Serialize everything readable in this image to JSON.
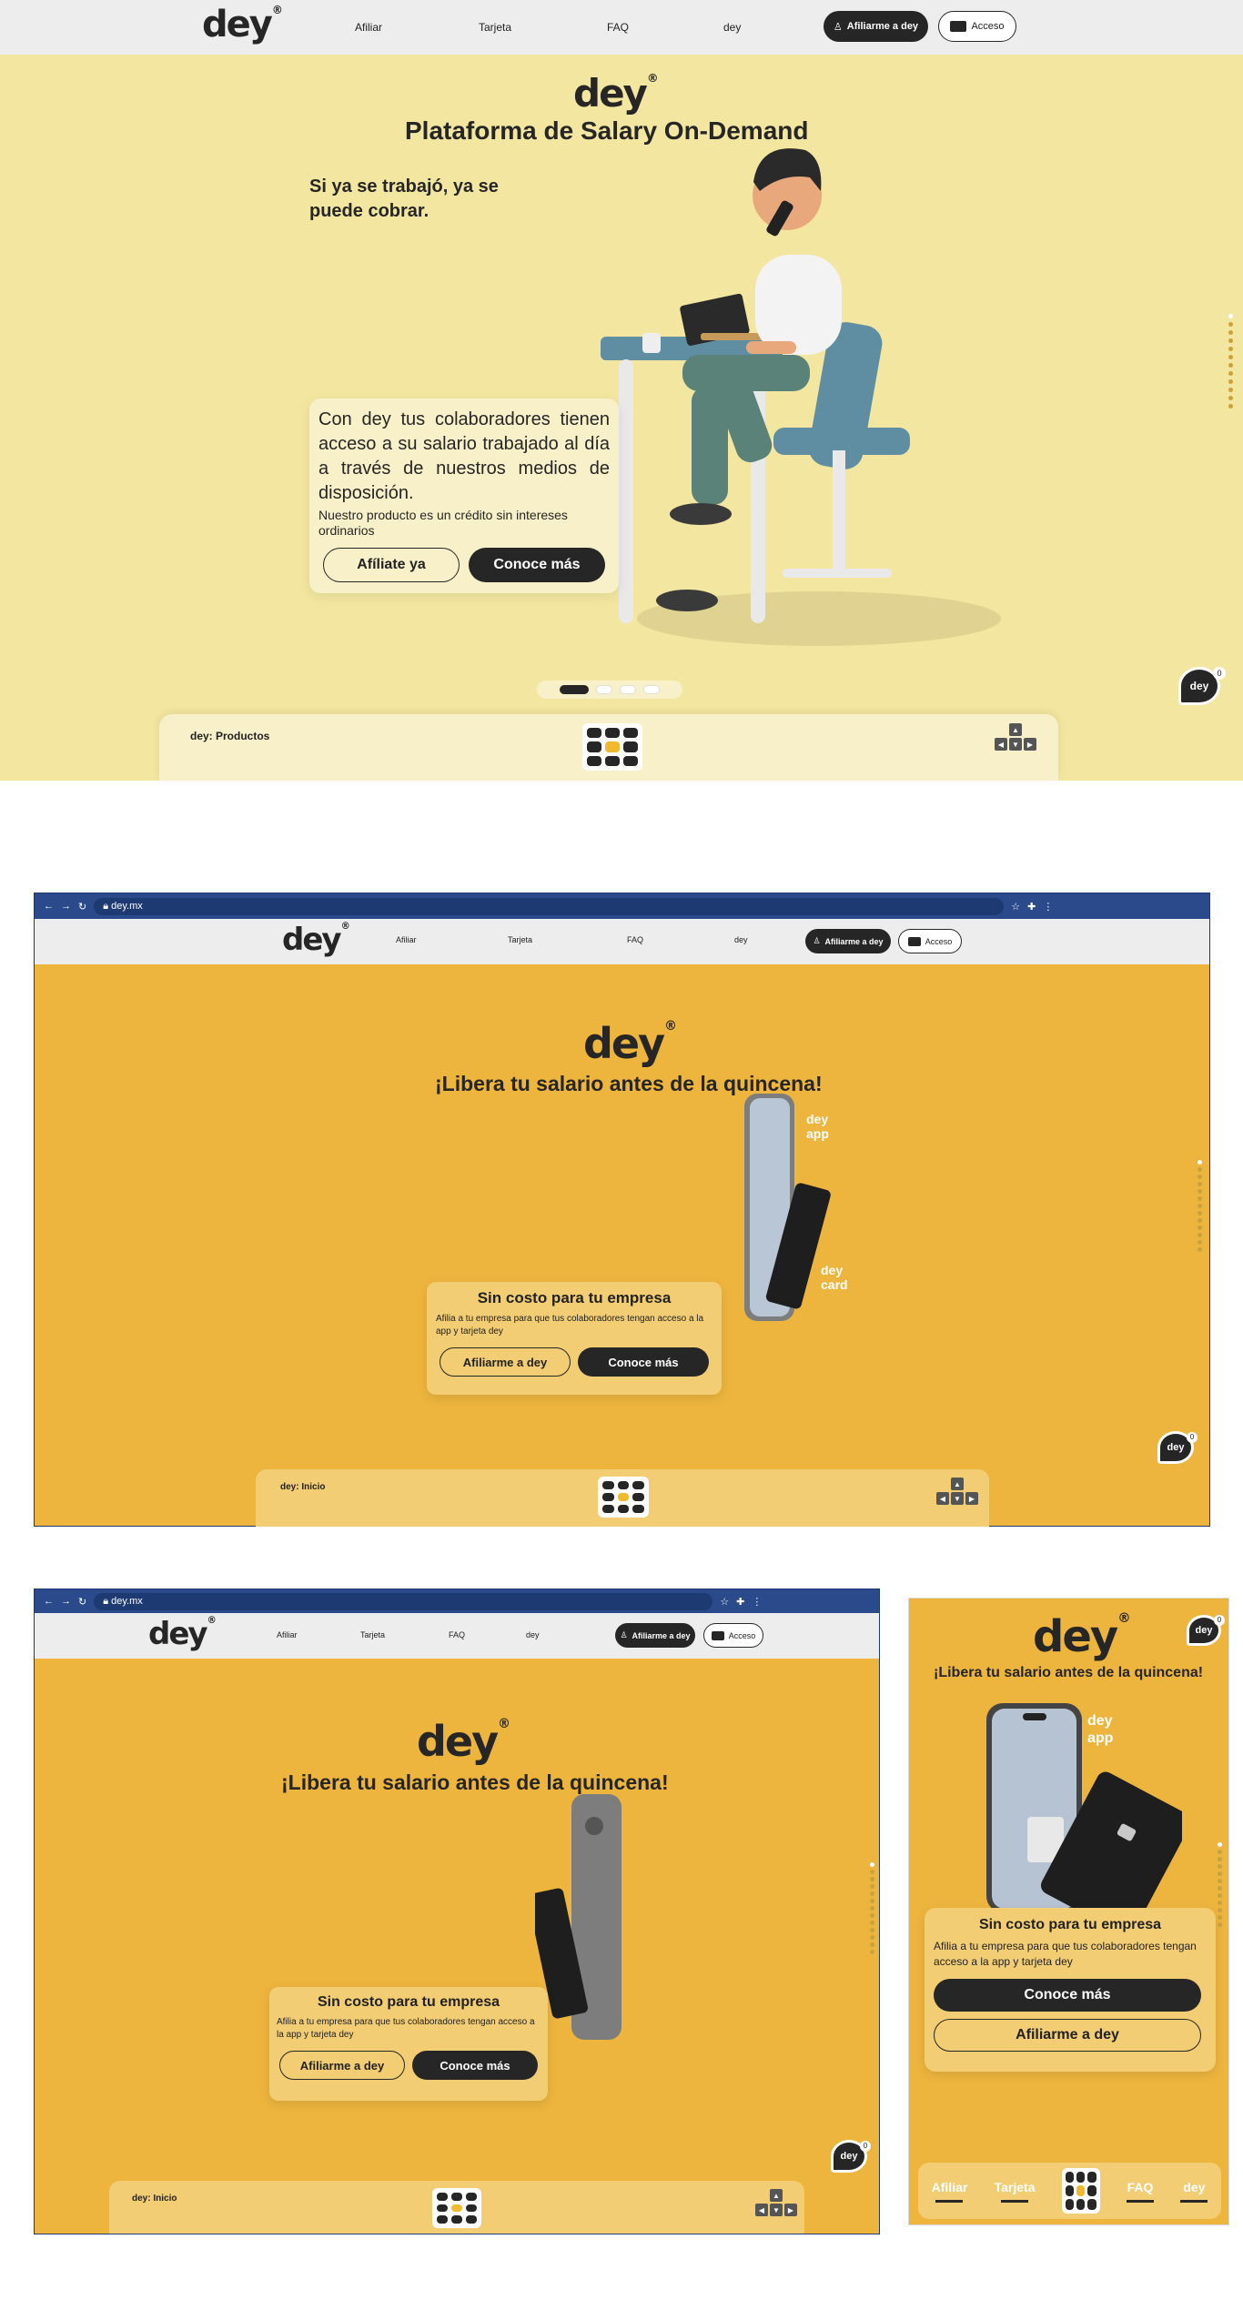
{
  "brand": {
    "logo": "dey",
    "reg": "®"
  },
  "nav": {
    "items": [
      "Afiliar",
      "Tarjeta",
      "FAQ",
      "dey"
    ],
    "cta_affiliate": "Afiliarme a dey",
    "cta_access": "Acceso"
  },
  "hero1": {
    "title": "Plataforma de Salary On-Demand",
    "tagline": "Si ya se trabajó, ya se puede cobrar.",
    "card_body": "Con dey tus colaboradores tienen acceso a su salario trabajado al día a través de nuestros medios de disposición.",
    "card_note": "Nuestro producto es un crédito sin intereses ordinarios",
    "btn_secondary": "Afíliate ya",
    "btn_primary": "Conoce más",
    "bottom_label": "dey: Productos"
  },
  "browser": {
    "url": "dey.mx"
  },
  "hero2": {
    "title": "¡Libera tu salario antes de la quincena!",
    "label_app": "dey app",
    "label_card": "dey card",
    "card_title": "Sin costo para tu empresa",
    "card_body": "Afilia a tu empresa para que tus colaboradores tengan acceso a la app y tarjeta dey",
    "btn_secondary": "Afiliarme a dey",
    "btn_primary": "Conoce más",
    "bottom_label": "dey: Inicio"
  },
  "mobile": {
    "title": "¡Libera tu salario antes de la quincena!",
    "label_app": "dey app",
    "card_title": "Sin costo para tu empresa",
    "card_body": "Afilia a tu empresa para que tus colaboradores tengan acceso a la app y tarjeta dey",
    "btn_primary": "Conoce más",
    "btn_secondary": "Afiliarme a dey",
    "tabs": [
      "Afiliar",
      "Tarjeta",
      "FAQ",
      "dey"
    ]
  },
  "chat": {
    "label": "dey",
    "badge": "0"
  },
  "colors": {
    "pale_yellow": "#f2e6a0",
    "gold": "#edb53e",
    "dark": "#262626",
    "chrome": "#2a4a8c"
  },
  "icons": [
    "user-icon",
    "id-card-icon",
    "grid-menu-icon",
    "arrow-keys-icon",
    "chat-bubble-icon",
    "back-icon",
    "forward-icon",
    "reload-icon",
    "lock-icon",
    "star-icon",
    "puzzle-icon",
    "kebab-icon"
  ]
}
